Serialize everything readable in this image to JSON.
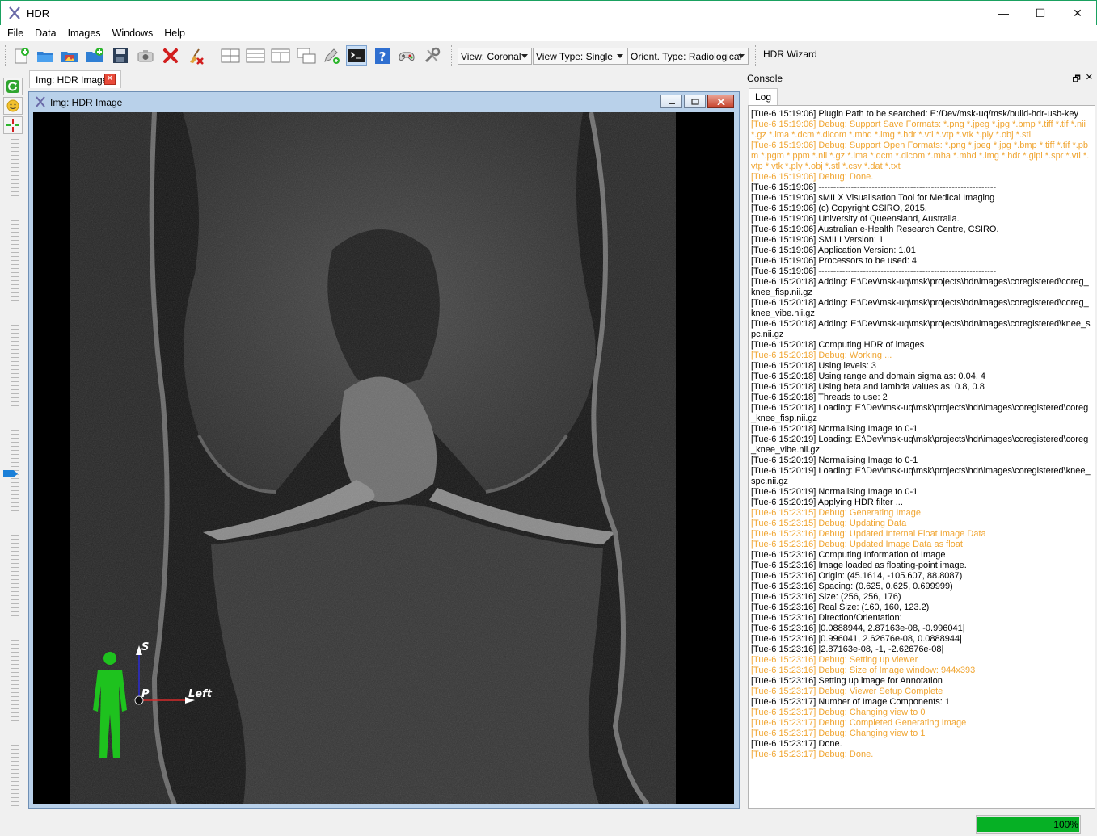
{
  "window": {
    "title": "HDR",
    "minimize": "—",
    "maximize": "☐",
    "close": "✕"
  },
  "menu": [
    "File",
    "Data",
    "Images",
    "Windows",
    "Help"
  ],
  "toolbar": {
    "combos": [
      {
        "label": "View: Coronal"
      },
      {
        "label": "View Type: Single"
      },
      {
        "label": "Orient. Type: Radiological"
      }
    ],
    "wizard_label": "HDR Wizard"
  },
  "tab": {
    "label": "Img: HDR Image",
    "close": "✕"
  },
  "subwindow": {
    "title": "Img: HDR Image"
  },
  "orientation": {
    "superior": "S",
    "posterior": "P",
    "left": "Left"
  },
  "console": {
    "title": "Console",
    "tab": "Log",
    "lines": [
      {
        "t": "[Tue-6 15:19:06] Plugin Path to be searched: E:/Dev/msk-uq/msk/build-hdr-usb-key",
        "d": false
      },
      {
        "t": "[Tue-6 15:19:06] Debug: Support Save Formats: *.png *.jpeg *.jpg *.bmp *.tiff *.tif *.nii *.gz *.ima *.dcm *.dicom *.mhd *.img *.hdr *.vti *.vtp *.vtk *.ply *.obj *.stl",
        "d": true
      },
      {
        "t": "[Tue-6 15:19:06] Debug: Support Open Formats: *.png *.jpeg *.jpg *.bmp *.tiff *.tif *.pbm *.pgm *.ppm *.nii *.gz *.ima *.dcm *.dicom *.mha *.mhd *.img *.hdr *.gipl *.spr *.vti *.vtp *.vtk *.ply *.obj *.stl *.csv *.dat *.txt",
        "d": true
      },
      {
        "t": "[Tue-6 15:19:06] Debug: Done.",
        "d": true
      },
      {
        "t": "[Tue-6 15:19:06] ------------------------------------------------------------",
        "d": false
      },
      {
        "t": "[Tue-6 15:19:06] sMILX Visualisation Tool for Medical Imaging",
        "d": false
      },
      {
        "t": "[Tue-6 15:19:06] (c) Copyright CSIRO, 2015.",
        "d": false
      },
      {
        "t": "[Tue-6 15:19:06] University of Queensland, Australia.",
        "d": false
      },
      {
        "t": "[Tue-6 15:19:06] Australian e-Health Research Centre, CSIRO.",
        "d": false
      },
      {
        "t": "[Tue-6 15:19:06] SMILI Version: 1",
        "d": false
      },
      {
        "t": "[Tue-6 15:19:06] Application Version: 1.01",
        "d": false
      },
      {
        "t": "[Tue-6 15:19:06] Processors to be used: 4",
        "d": false
      },
      {
        "t": "[Tue-6 15:19:06] ------------------------------------------------------------",
        "d": false
      },
      {
        "t": "[Tue-6 15:20:18] Adding: E:\\Dev\\msk-uq\\msk\\projects\\hdr\\images\\coregistered\\coreg_knee_fisp.nii.gz",
        "d": false
      },
      {
        "t": "[Tue-6 15:20:18] Adding: E:\\Dev\\msk-uq\\msk\\projects\\hdr\\images\\coregistered\\coreg_knee_vibe.nii.gz",
        "d": false
      },
      {
        "t": "[Tue-6 15:20:18] Adding: E:\\Dev\\msk-uq\\msk\\projects\\hdr\\images\\coregistered\\knee_spc.nii.gz",
        "d": false
      },
      {
        "t": "[Tue-6 15:20:18] Computing HDR of images",
        "d": false
      },
      {
        "t": "[Tue-6 15:20:18] Debug: Working ...",
        "d": true
      },
      {
        "t": "[Tue-6 15:20:18] Using levels: 3",
        "d": false
      },
      {
        "t": "[Tue-6 15:20:18] Using range and domain sigma as: 0.04, 4",
        "d": false
      },
      {
        "t": "[Tue-6 15:20:18] Using beta and lambda values as: 0.8, 0.8",
        "d": false
      },
      {
        "t": "[Tue-6 15:20:18] Threads to use: 2",
        "d": false
      },
      {
        "t": "[Tue-6 15:20:18] Loading: E:\\Dev\\msk-uq\\msk\\projects\\hdr\\images\\coregistered\\coreg_knee_fisp.nii.gz",
        "d": false
      },
      {
        "t": "[Tue-6 15:20:18] Normalising Image to 0-1",
        "d": false
      },
      {
        "t": "[Tue-6 15:20:19] Loading: E:\\Dev\\msk-uq\\msk\\projects\\hdr\\images\\coregistered\\coreg_knee_vibe.nii.gz",
        "d": false
      },
      {
        "t": "[Tue-6 15:20:19] Normalising Image to 0-1",
        "d": false
      },
      {
        "t": "[Tue-6 15:20:19] Loading: E:\\Dev\\msk-uq\\msk\\projects\\hdr\\images\\coregistered\\knee_spc.nii.gz",
        "d": false
      },
      {
        "t": "[Tue-6 15:20:19] Normalising Image to 0-1",
        "d": false
      },
      {
        "t": "[Tue-6 15:20:19] Applying HDR filter ...",
        "d": false
      },
      {
        "t": "[Tue-6 15:23:15] Debug: Generating Image",
        "d": true
      },
      {
        "t": "[Tue-6 15:23:15] Debug: Updating Data",
        "d": true
      },
      {
        "t": "[Tue-6 15:23:16] Debug: Updated Internal Float Image Data",
        "d": true
      },
      {
        "t": "[Tue-6 15:23:16] Debug: Updated Image Data as float",
        "d": true
      },
      {
        "t": "[Tue-6 15:23:16] Computing Information of Image",
        "d": false
      },
      {
        "t": "[Tue-6 15:23:16] Image loaded as floating-point image.",
        "d": false
      },
      {
        "t": "[Tue-6 15:23:16] Origin: (45.1614, -105.607, 88.8087)",
        "d": false
      },
      {
        "t": "[Tue-6 15:23:16] Spacing: (0.625, 0.625, 0.699999)",
        "d": false
      },
      {
        "t": "[Tue-6 15:23:16] Size: (256, 256, 176)",
        "d": false
      },
      {
        "t": "[Tue-6 15:23:16] Real Size: (160, 160, 123.2)",
        "d": false
      },
      {
        "t": "[Tue-6 15:23:16] Direction/Orientation:",
        "d": false
      },
      {
        "t": "[Tue-6 15:23:16] |0.0888944, 2.87163e-08, -0.996041|",
        "d": false
      },
      {
        "t": "[Tue-6 15:23:16] |0.996041, 2.62676e-08, 0.0888944|",
        "d": false
      },
      {
        "t": "[Tue-6 15:23:16] |2.87163e-08, -1, -2.62676e-08|",
        "d": false
      },
      {
        "t": "[Tue-6 15:23:16] Debug: Setting up viewer",
        "d": true
      },
      {
        "t": "[Tue-6 15:23:16] Debug: Size of Image window: 944x393",
        "d": true
      },
      {
        "t": "[Tue-6 15:23:16] Setting up image for Annotation",
        "d": false
      },
      {
        "t": "[Tue-6 15:23:17] Debug: Viewer Setup Complete",
        "d": true
      },
      {
        "t": "[Tue-6 15:23:17] Number of Image Components: 1",
        "d": false
      },
      {
        "t": "[Tue-6 15:23:17] Debug: Changing view to 0",
        "d": true
      },
      {
        "t": "[Tue-6 15:23:17] Debug: Completed Generating Image",
        "d": true
      },
      {
        "t": "[Tue-6 15:23:17] Debug: Changing view to 1",
        "d": true
      },
      {
        "t": "[Tue-6 15:23:17] Done.",
        "d": false
      },
      {
        "t": "[Tue-6 15:23:17] Debug: Done.",
        "d": true
      }
    ]
  },
  "status": {
    "progress_percent": 100,
    "progress_label": "100%"
  },
  "colors": {
    "debug": "#f0a531",
    "progress": "#06b025",
    "titlebar_border": "#1aa160"
  }
}
